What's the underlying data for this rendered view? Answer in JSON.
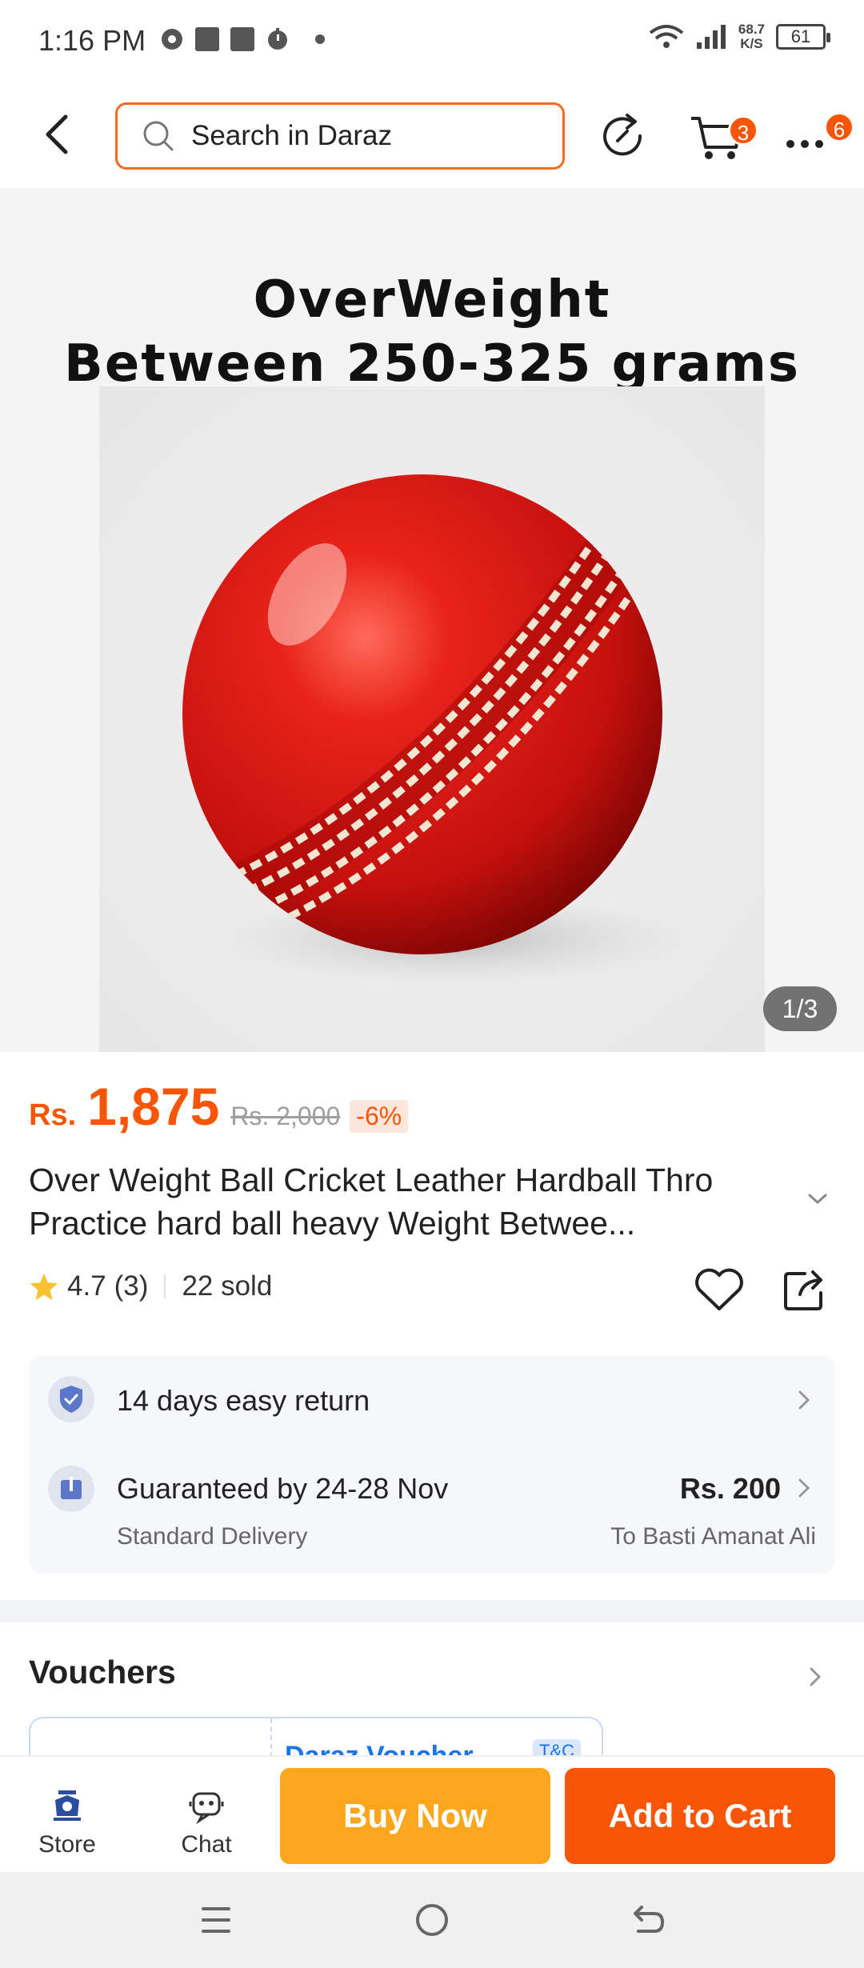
{
  "status_bar": {
    "time": "1:16 PM",
    "speed_value": "68.7",
    "speed_unit": "K/S",
    "battery": "61"
  },
  "header": {
    "search_placeholder": "Search in Daraz",
    "cart_badge": "3",
    "more_badge": "6"
  },
  "gallery": {
    "caption_line1": "OverWeight",
    "caption_line2": "Between 250-325 grams",
    "counter": "1/3"
  },
  "product": {
    "currency": "Rs.",
    "price": "1,875",
    "old_price": "Rs. 2,000",
    "discount": "-6%",
    "title": "Over Weight Ball Cricket Leather Hardball Thro Practice hard ball heavy Weight Betwee...",
    "rating": "4.7",
    "rating_count": "(3)",
    "sold": "22 sold"
  },
  "services": {
    "return_text": "14 days easy return",
    "delivery_text": "Guaranteed by 24-28 Nov",
    "delivery_sub": "Standard Delivery",
    "delivery_fee": "Rs. 200",
    "delivery_location": "To Basti Amanat Ali"
  },
  "vouchers": {
    "title": "Vouchers",
    "card_label": "Daraz Voucher",
    "tc": "T&C"
  },
  "actions": {
    "store_label": "Store",
    "chat_label": "Chat",
    "buy_now": "Buy Now",
    "add_to_cart": "Add to Cart"
  },
  "colors": {
    "accent": "#f85606",
    "buy_now": "#fba61d",
    "star": "#fbc02d"
  }
}
